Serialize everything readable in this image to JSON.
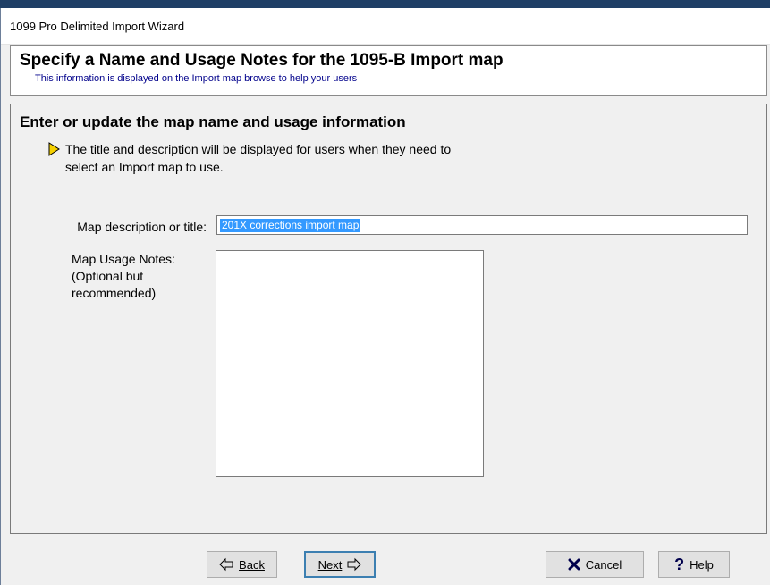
{
  "window": {
    "title": "1099 Pro Delimited Import Wizard"
  },
  "header": {
    "title": "Specify a Name and Usage Notes for the 1095-B Import map",
    "subtitle": "This information is displayed on the Import map browse to help your users"
  },
  "panel": {
    "heading": "Enter or update the map name and usage information",
    "info_line1": "The title and description will be displayed for users when they need to",
    "info_line2": "select an Import map to use.",
    "description_label": "Map description or title:",
    "description_value": "201X corrections import map",
    "notes_label_line1": "Map Usage Notes:",
    "notes_label_line2": "(Optional but",
    "notes_label_line3": "recommended)",
    "notes_value": ""
  },
  "buttons": {
    "back": "Back",
    "next": "Next",
    "cancel": "Cancel",
    "help": "Help"
  },
  "colors": {
    "bullet": "#f5d000",
    "selection": "#3399ff",
    "subtitle": "#00008b",
    "cancel_icon": "#00004d"
  },
  "icons": {
    "bullet": "triangle-right-icon",
    "back": "arrow-left-outline-icon",
    "next": "arrow-right-outline-icon",
    "cancel": "x-icon",
    "help": "question-mark-icon"
  }
}
